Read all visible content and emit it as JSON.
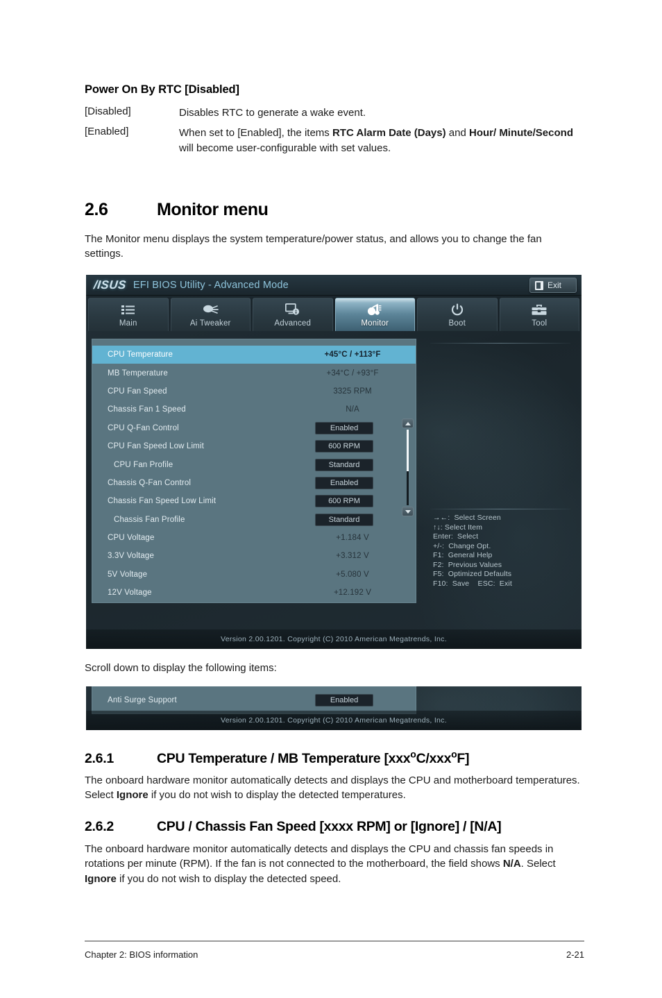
{
  "document": {
    "rtc_section": {
      "heading": "Power On By RTC [Disabled]",
      "rows": [
        {
          "term": "[Disabled]",
          "desc_plain": "Disables RTC to generate a wake event."
        },
        {
          "term": "[Enabled]",
          "desc_pre": "When set to [Enabled], the items ",
          "desc_b1": "RTC Alarm Date (Days)",
          "desc_mid": " and ",
          "desc_b2": "Hour/ Minute/Second",
          "desc_post": " will become user-configurable with set values."
        }
      ]
    },
    "section_26": {
      "number": "2.6",
      "title": "Monitor menu",
      "intro": "The Monitor menu displays the system temperature/power status, and allows you to change the fan settings."
    },
    "scroll_note": "Scroll down to display the following items:",
    "section_261": {
      "number": "2.6.1",
      "title_a": "CPU Temperature / MB Temperature [xxx",
      "title_deg1": "o",
      "title_b": "C/xxx",
      "title_deg2": "o",
      "title_c": "F]",
      "body_pre": "The onboard hardware monitor automatically detects and displays the CPU and motherboard temperatures. Select ",
      "body_bold": "Ignore",
      "body_post": " if you do not wish to display the detected temperatures."
    },
    "section_262": {
      "number": "2.6.2",
      "title": "CPU / Chassis Fan Speed [xxxx RPM] or [Ignore] / [N/A]",
      "body_pre": "The onboard hardware monitor automatically detects and displays the CPU and chassis fan speeds in rotations per minute (RPM). If the fan is not connected to the motherboard, the field shows ",
      "body_bold1": "N/A",
      "body_mid": ". Select ",
      "body_bold2": "Ignore",
      "body_post": " if you do not wish to display the detected speed."
    },
    "footer": {
      "chapter": "Chapter 2: BIOS information",
      "page": "2-21"
    }
  },
  "bios": {
    "brand": "/ISUS",
    "title": "EFI BIOS Utility - Advanced Mode",
    "exit_label": "Exit",
    "tabs": [
      {
        "label": "Main",
        "icon": "list-icon",
        "active": false
      },
      {
        "label": "Ai  Tweaker",
        "icon": "tuning-icon",
        "active": false
      },
      {
        "label": "Advanced",
        "icon": "monitor-info-icon",
        "active": false
      },
      {
        "label": "Monitor",
        "icon": "thermometer-fan-icon",
        "active": true
      },
      {
        "label": "Boot",
        "icon": "power-icon",
        "active": false
      },
      {
        "label": "Tool",
        "icon": "toolbox-icon",
        "active": false
      }
    ],
    "items": [
      {
        "label": "CPU Temperature",
        "value": "+45°C / +113°F",
        "type": "text",
        "selected": true,
        "indent": false
      },
      {
        "label": "MB Temperature",
        "value": "+34°C / +93°F",
        "type": "text",
        "selected": false,
        "indent": false
      },
      {
        "label": "CPU Fan Speed",
        "value": "3325 RPM",
        "type": "text",
        "selected": false,
        "indent": false
      },
      {
        "label": "Chassis Fan 1 Speed",
        "value": "N/A",
        "type": "text",
        "selected": false,
        "indent": false
      },
      {
        "label": "CPU Q-Fan Control",
        "value": "Enabled",
        "type": "field",
        "selected": false,
        "indent": false
      },
      {
        "label": "CPU Fan Speed Low Limit",
        "value": "600 RPM",
        "type": "field",
        "selected": false,
        "indent": false
      },
      {
        "label": "CPU Fan Profile",
        "value": "Standard",
        "type": "field",
        "selected": false,
        "indent": true
      },
      {
        "label": "Chassis Q-Fan Control",
        "value": "Enabled",
        "type": "field",
        "selected": false,
        "indent": false
      },
      {
        "label": "Chassis Fan Speed Low Limit",
        "value": "600 RPM",
        "type": "field",
        "selected": false,
        "indent": false
      },
      {
        "label": "Chassis Fan Profile",
        "value": "Standard",
        "type": "field",
        "selected": false,
        "indent": true
      },
      {
        "label": "CPU Voltage",
        "value": "+1.184 V",
        "type": "text",
        "selected": false,
        "indent": false
      },
      {
        "label": "3.3V Voltage",
        "value": "+3.312 V",
        "type": "text",
        "selected": false,
        "indent": false
      },
      {
        "label": "5V Voltage",
        "value": "+5.080 V",
        "type": "text",
        "selected": false,
        "indent": false
      },
      {
        "label": "12V Voltage",
        "value": "+12.192 V",
        "type": "text",
        "selected": false,
        "indent": false
      }
    ],
    "keys": [
      "→←:  Select Screen",
      "↑↓: Select Item",
      "Enter:  Select",
      "+/-:  Change Opt.",
      "F1:  General Help",
      "F2:  Previous Values",
      "F5:  Optimized Defaults",
      "F10:  Save    ESC:  Exit"
    ],
    "version": "Version  2.00.1201.   Copyright  (C)  2010  American  Megatrends,  Inc.",
    "scroll_item": {
      "label": "Anti Surge Support",
      "value": "Enabled"
    },
    "colors": {
      "selected_row": "#62b3d2",
      "list_panel": "#5a7580",
      "field_bg": "#1b232a",
      "accent_title": "#8fc5dd"
    }
  }
}
